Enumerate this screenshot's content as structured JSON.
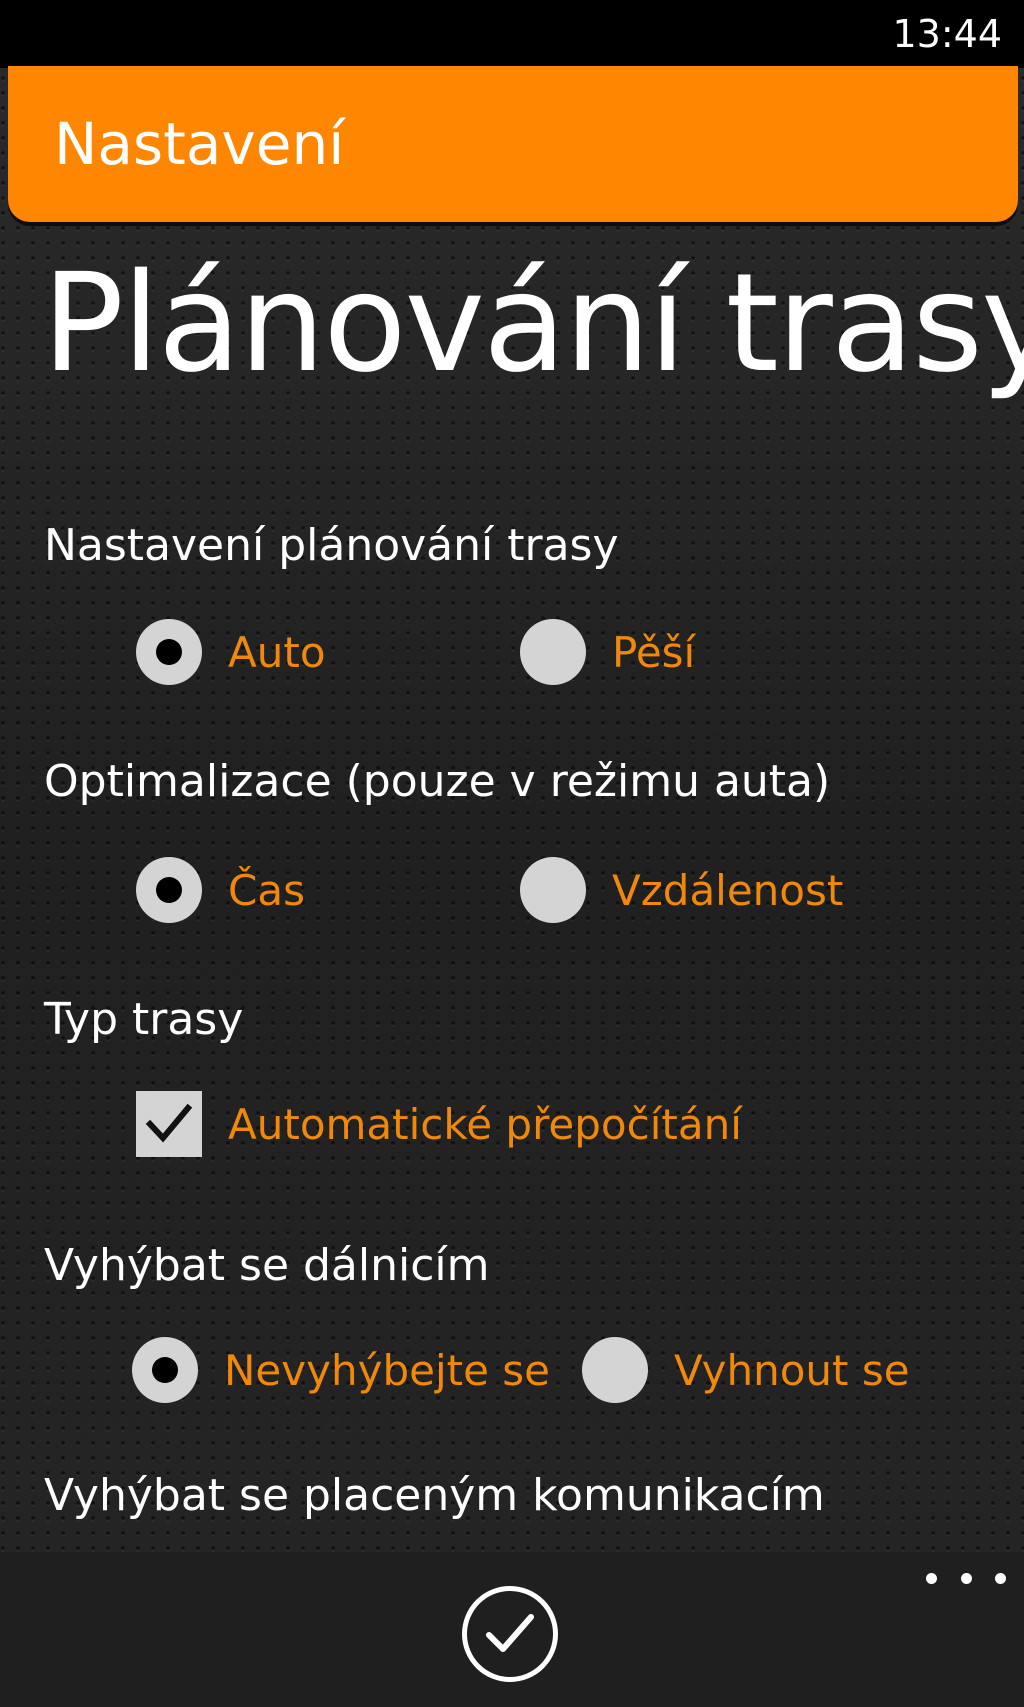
{
  "status_bar": {
    "time": "13:44"
  },
  "header": {
    "title": "Nastavení"
  },
  "page": {
    "title": "Plánování trasy"
  },
  "sections": {
    "route_mode": {
      "label": "Nastavení plánování trasy",
      "options": [
        {
          "label": "Auto",
          "checked": true
        },
        {
          "label": "Pěší",
          "checked": false
        }
      ]
    },
    "optimization": {
      "label": "Optimalizace (pouze v režimu auta)",
      "options": [
        {
          "label": "Čas",
          "checked": true
        },
        {
          "label": "Vzdálenost",
          "checked": false
        }
      ]
    },
    "route_type": {
      "label": "Typ trasy",
      "checkbox": {
        "label": "Automatické přepočítání",
        "checked": true
      }
    },
    "avoid_highways": {
      "label": "Vyhýbat se dálnicím",
      "options": [
        {
          "label": "Nevyhýbejte se",
          "checked": true
        },
        {
          "label": "Vyhnout se",
          "checked": false
        }
      ]
    },
    "avoid_tolls": {
      "label": "Vyhýbat se placeným komunikacím"
    }
  },
  "app_bar": {
    "confirm_icon": "checkmark-icon",
    "more_icon": "more-icon"
  },
  "colors": {
    "accent": "#ff8600",
    "option_text": "#f0880c",
    "control": "#d4d4d4"
  }
}
